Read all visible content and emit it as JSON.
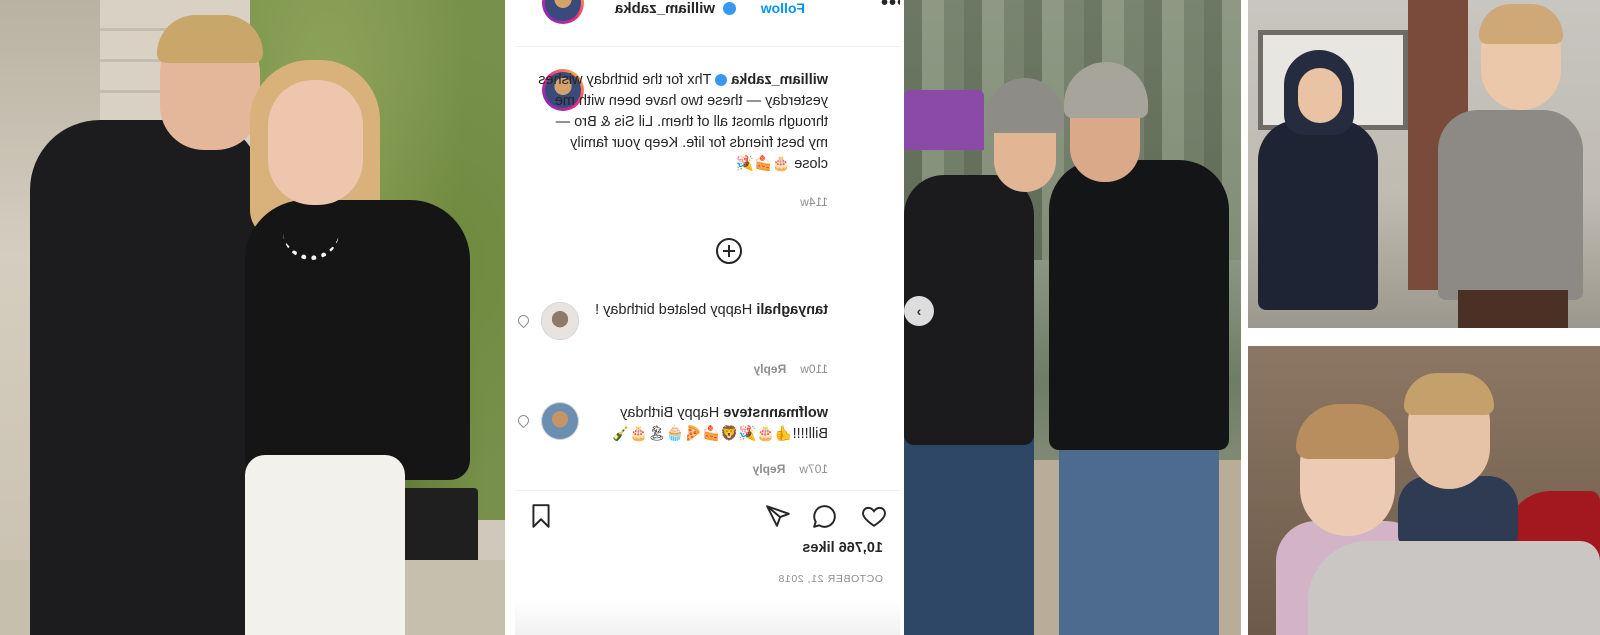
{
  "post": {
    "header": {
      "username": "william_zabka",
      "follow_label": "Follow",
      "more_label": "•••"
    },
    "caption": {
      "username": "william_zabka",
      "text": "Thx for the birthday wishes yesterday — these two have been with me through almost all of them. Lil Sis & Bro — my best friends for life. Keep your family close 🎂🍰🎉",
      "age": "114w"
    },
    "comments": [
      {
        "username": "tanyaghali",
        "text": "Happy belated birthday !",
        "age": "110w",
        "reply_label": "Reply"
      },
      {
        "username": "wolfmannsteve",
        "text": "Happy Birthday Bill!!!!👍🎂🎉🦁🍰🍕🧁🏝🎂🍾",
        "age": "107w",
        "reply_label": "Reply"
      }
    ],
    "likes": "10,766 likes",
    "date": "OCTOBER 21, 2018",
    "icons": {
      "like": "heart-icon",
      "comment": "comment-icon",
      "share": "share-icon",
      "save": "bookmark-icon",
      "add": "plus-circle-icon"
    },
    "colors": {
      "link": "#0095f6",
      "verified": "#3897f0",
      "text": "#262626",
      "muted": "#8e8e8e"
    }
  }
}
